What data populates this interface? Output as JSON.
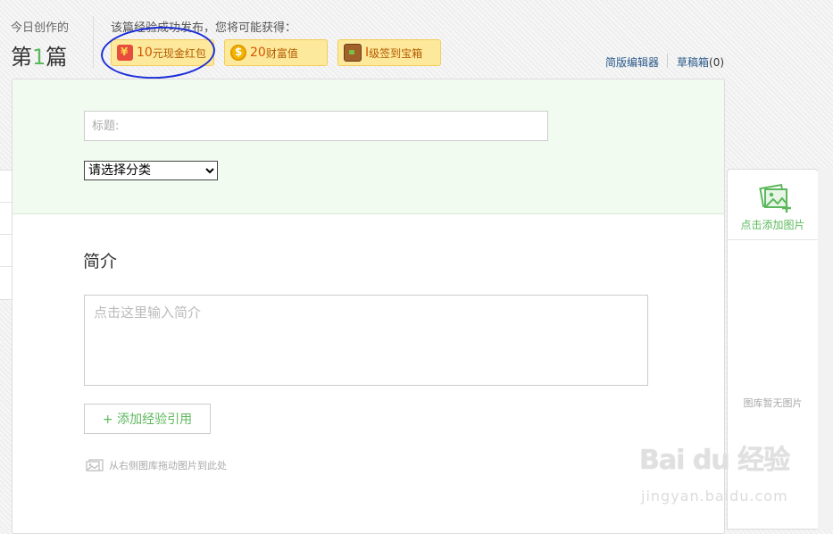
{
  "header": {
    "today_label": "今日创作的",
    "today_prefix": "第",
    "today_number": "1",
    "today_suffix": "篇",
    "reward_hint": "该篇经验成功发布，您将可能获得：",
    "badges": [
      {
        "icon": "red-packet-icon",
        "number": "10",
        "text": "元现金红包"
      },
      {
        "icon": "coin-icon",
        "number": "20",
        "text": "财富值"
      },
      {
        "icon": "treasure-chest-icon",
        "number": "I",
        "text": "级签到宝箱"
      }
    ],
    "links": {
      "simple_editor": "简版编辑器",
      "drafts": "草稿箱",
      "drafts_count": "(0)"
    }
  },
  "editor": {
    "title_placeholder": "标题:",
    "category_selected": "请选择分类",
    "intro_heading": "简介",
    "intro_placeholder": "点击这里输入简介",
    "add_reference_label": "+ 添加经验引用",
    "drag_hint": "从右侧图库拖动图片到此处"
  },
  "gallery": {
    "add_label": "点击添加图片",
    "empty_label": "图库暂无图片"
  },
  "watermark": {
    "logo": "Bai du 经验",
    "url": "jingyan.baidu.com"
  },
  "colors": {
    "accent_green": "#5cb85c",
    "badge_bg": "#fde99b",
    "link_blue": "#2a5a8a",
    "annotation_blue": "#1a2dd8"
  }
}
